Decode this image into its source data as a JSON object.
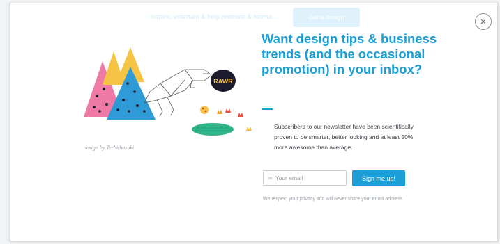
{
  "background": {
    "bar_text": "Inspire, entertain & help promote & formul...",
    "bar_button": "Get a design"
  },
  "close": {
    "label": "×"
  },
  "illustration": {
    "speech_bubble": "RAWR"
  },
  "credit": "design by Terbithosuki",
  "headline": "Want design tips & business trends (and the occasional promotion) in your inbox?",
  "body": "Subscribers to our newsletter have been scientifically proven to be smarter, better looking and at least 50% more awesome than average.",
  "form": {
    "email_placeholder": "Your email",
    "email_value": "",
    "submit_label": "Sign me up!"
  },
  "privacy": "We respect your privacy and will never share your email address.",
  "colors": {
    "accent": "#1b9fd6",
    "text": "#3a3f45",
    "muted": "#9aa0a6"
  }
}
